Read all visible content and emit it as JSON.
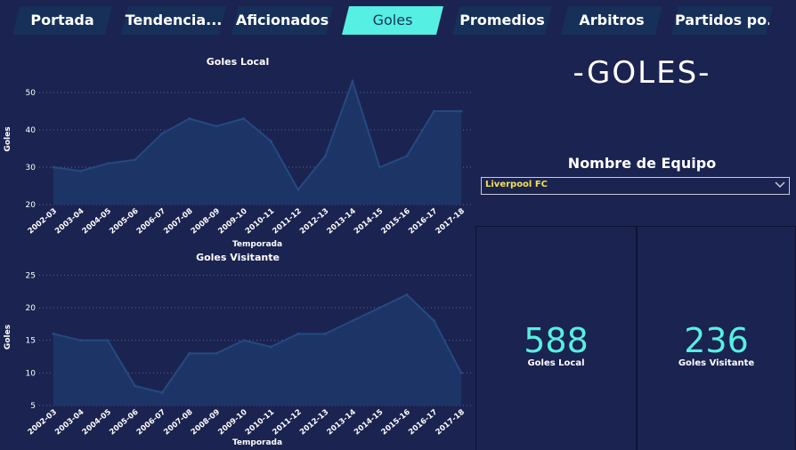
{
  "tabs": [
    {
      "label": "Portada",
      "active": false
    },
    {
      "label": "Tendencia...",
      "active": false
    },
    {
      "label": "Aficionados",
      "active": false
    },
    {
      "label": "Goles",
      "active": true
    },
    {
      "label": "Promedios",
      "active": false
    },
    {
      "label": "Arbitros",
      "active": false
    },
    {
      "label": "Partidos po...",
      "active": false
    }
  ],
  "page_title": "-GOLES-",
  "slicer": {
    "label": "Nombre de Equipo",
    "value": "Liverpool FC"
  },
  "cards": [
    {
      "value": "588",
      "label": "Goles Local"
    },
    {
      "value": "236",
      "label": "Goles Visitante"
    }
  ],
  "colors": {
    "background": "#1b2350",
    "tab": "#16305a",
    "tab_active": "#55f0e3",
    "accent": "#55f0e3",
    "area_fill": "#1d3566",
    "area_line": "#244a80",
    "slicer_text": "#f4e04d"
  },
  "chart_data": [
    {
      "type": "area",
      "title": "Goles Local",
      "xlabel": "Temporada",
      "ylabel": "Goles",
      "categories": [
        "2002-03",
        "2003-04",
        "2004-05",
        "2005-06",
        "2006-07",
        "2007-08",
        "2008-09",
        "2009-10",
        "2010-11",
        "2011-12",
        "2012-13",
        "2013-14",
        "2014-15",
        "2015-16",
        "2016-17",
        "2017-18"
      ],
      "values": [
        30,
        29,
        31,
        32,
        39,
        43,
        41,
        43,
        37,
        24,
        33,
        53,
        30,
        33,
        45,
        45
      ],
      "yticks": [
        20,
        30,
        40,
        50
      ],
      "ylim": [
        20,
        55
      ],
      "grid": true
    },
    {
      "type": "area",
      "title": "Goles Visitante",
      "xlabel": "Temporada",
      "ylabel": "Goles",
      "categories": [
        "2002-03",
        "2003-04",
        "2004-05",
        "2005-06",
        "2006-07",
        "2007-08",
        "2008-09",
        "2009-10",
        "2010-11",
        "2011-12",
        "2012-13",
        "2013-14",
        "2014-15",
        "2015-16",
        "2016-17",
        "2017-18"
      ],
      "values": [
        16,
        15,
        15,
        8,
        7,
        13,
        13,
        15,
        14,
        16,
        16,
        18,
        20,
        22,
        18,
        10
      ],
      "yticks": [
        5,
        10,
        15,
        20,
        25
      ],
      "ylim": [
        5,
        26
      ],
      "grid": true
    }
  ]
}
